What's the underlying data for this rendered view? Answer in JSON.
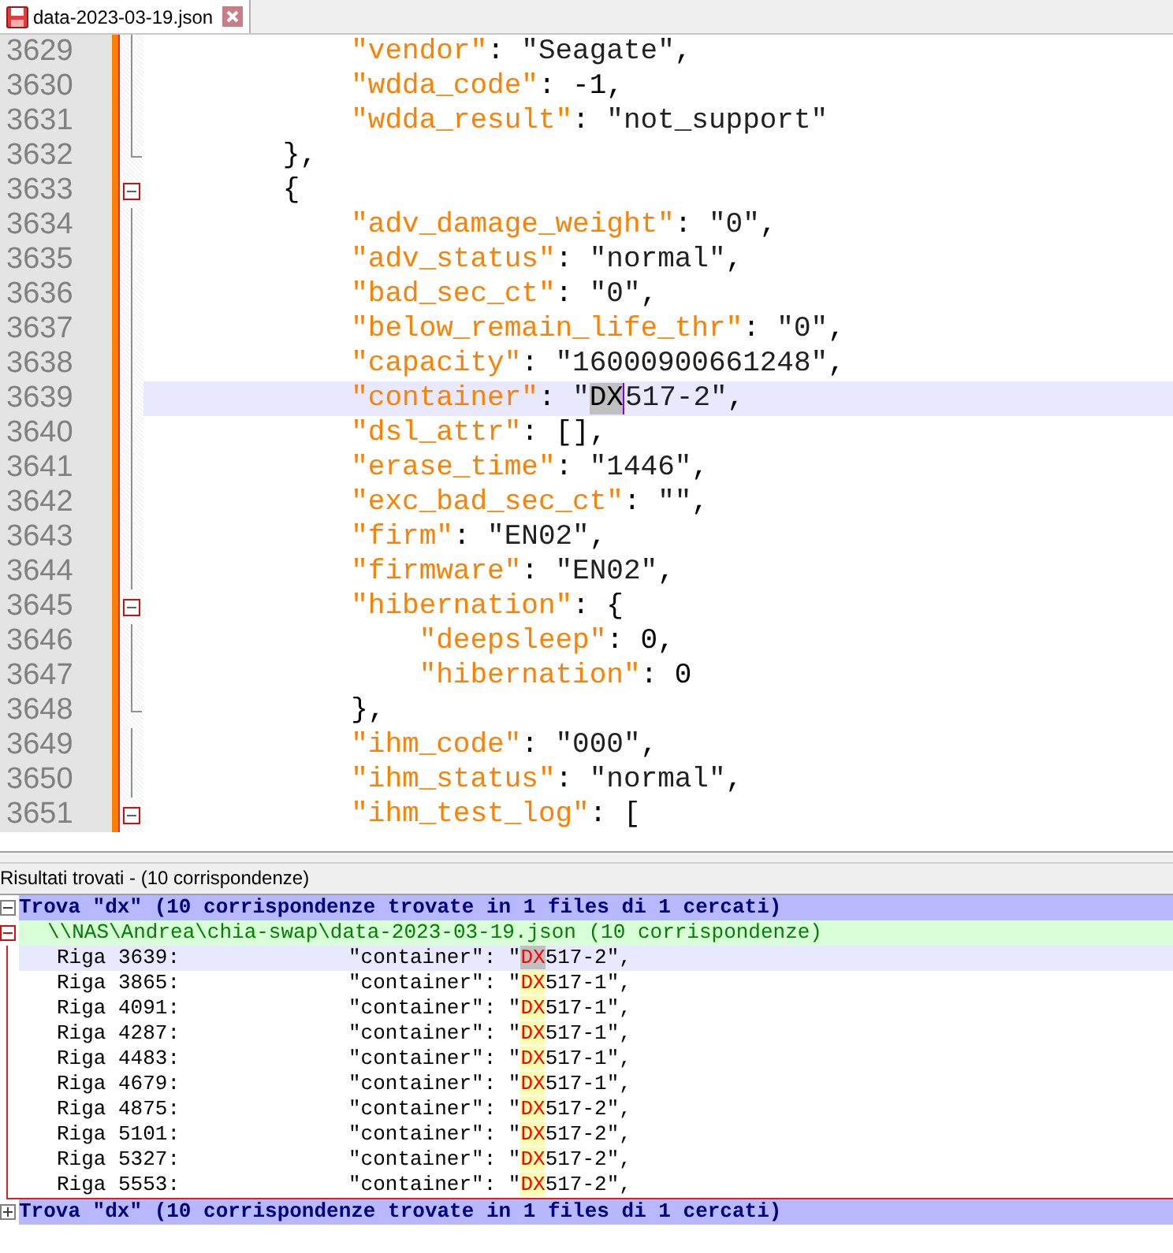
{
  "tab": {
    "title": "data-2023-03-19.json",
    "selected": true
  },
  "editor": {
    "lines": [
      {
        "number": "3629",
        "kind": "inner",
        "selected": false,
        "code": [
          {
            "kind": "key",
            "text": "            \"vendor\""
          },
          {
            "kind": "plain",
            "text": ": "
          },
          {
            "kind": "string",
            "text": "\"Seagate\""
          },
          {
            "kind": "plain",
            "text": ","
          }
        ]
      },
      {
        "number": "3630",
        "kind": "inner",
        "selected": false,
        "code": [
          {
            "kind": "key",
            "text": "            \"wdda_code\""
          },
          {
            "kind": "plain",
            "text": ": -1,"
          }
        ]
      },
      {
        "number": "3631",
        "kind": "inner",
        "selected": false,
        "code": [
          {
            "kind": "key",
            "text": "            \"wdda_result\""
          },
          {
            "kind": "plain",
            "text": ": "
          },
          {
            "kind": "string",
            "text": "\"not_support\""
          }
        ]
      },
      {
        "number": "3632",
        "kind": "close",
        "selected": false,
        "code": [
          {
            "kind": "plain",
            "text": "        },"
          }
        ]
      },
      {
        "number": "3633",
        "kind": "open",
        "selected": false,
        "code": [
          {
            "kind": "plain",
            "text": "        {"
          }
        ]
      },
      {
        "number": "3634",
        "kind": "inner",
        "selected": false,
        "code": [
          {
            "kind": "key",
            "text": "            \"adv_damage_weight\""
          },
          {
            "kind": "plain",
            "text": ": "
          },
          {
            "kind": "string",
            "text": "\"0\""
          },
          {
            "kind": "plain",
            "text": ","
          }
        ]
      },
      {
        "number": "3635",
        "kind": "inner",
        "selected": false,
        "code": [
          {
            "kind": "key",
            "text": "            \"adv_status\""
          },
          {
            "kind": "plain",
            "text": ": "
          },
          {
            "kind": "string",
            "text": "\"normal\""
          },
          {
            "kind": "plain",
            "text": ","
          }
        ]
      },
      {
        "number": "3636",
        "kind": "inner",
        "selected": false,
        "code": [
          {
            "kind": "key",
            "text": "            \"bad_sec_ct\""
          },
          {
            "kind": "plain",
            "text": ": "
          },
          {
            "kind": "string",
            "text": "\"0\""
          },
          {
            "kind": "plain",
            "text": ","
          }
        ]
      },
      {
        "number": "3637",
        "kind": "inner",
        "selected": false,
        "code": [
          {
            "kind": "key",
            "text": "            \"below_remain_life_thr\""
          },
          {
            "kind": "plain",
            "text": ": "
          },
          {
            "kind": "string",
            "text": "\"0\""
          },
          {
            "kind": "plain",
            "text": ","
          }
        ]
      },
      {
        "number": "3638",
        "kind": "inner",
        "selected": false,
        "code": [
          {
            "kind": "key",
            "text": "            \"capacity\""
          },
          {
            "kind": "plain",
            "text": ": "
          },
          {
            "kind": "string",
            "text": "\"16000900661248\""
          },
          {
            "kind": "plain",
            "text": ","
          }
        ]
      },
      {
        "number": "3639",
        "kind": "inner",
        "selected": true,
        "code": [
          {
            "kind": "key",
            "text": "            \"container\""
          },
          {
            "kind": "plain",
            "text": ": "
          },
          {
            "kind": "string",
            "text": "\""
          },
          {
            "kind": "match",
            "text": "DX"
          },
          {
            "kind": "string",
            "text": "517-2\""
          },
          {
            "kind": "plain",
            "text": ","
          }
        ]
      },
      {
        "number": "3640",
        "kind": "inner",
        "selected": false,
        "code": [
          {
            "kind": "key",
            "text": "            \"dsl_attr\""
          },
          {
            "kind": "plain",
            "text": ": [],"
          }
        ]
      },
      {
        "number": "3641",
        "kind": "inner",
        "selected": false,
        "code": [
          {
            "kind": "key",
            "text": "            \"erase_time\""
          },
          {
            "kind": "plain",
            "text": ": "
          },
          {
            "kind": "string",
            "text": "\"1446\""
          },
          {
            "kind": "plain",
            "text": ","
          }
        ]
      },
      {
        "number": "3642",
        "kind": "inner",
        "selected": false,
        "code": [
          {
            "kind": "key",
            "text": "            \"exc_bad_sec_ct\""
          },
          {
            "kind": "plain",
            "text": ": "
          },
          {
            "kind": "string",
            "text": "\"\""
          },
          {
            "kind": "plain",
            "text": ","
          }
        ]
      },
      {
        "number": "3643",
        "kind": "inner",
        "selected": false,
        "code": [
          {
            "kind": "key",
            "text": "            \"firm\""
          },
          {
            "kind": "plain",
            "text": ": "
          },
          {
            "kind": "string",
            "text": "\"EN02\""
          },
          {
            "kind": "plain",
            "text": ","
          }
        ]
      },
      {
        "number": "3644",
        "kind": "inner",
        "selected": false,
        "code": [
          {
            "kind": "key",
            "text": "            \"firmware\""
          },
          {
            "kind": "plain",
            "text": ": "
          },
          {
            "kind": "string",
            "text": "\"EN02\""
          },
          {
            "kind": "plain",
            "text": ","
          }
        ]
      },
      {
        "number": "3645",
        "kind": "open",
        "selected": false,
        "code": [
          {
            "kind": "key",
            "text": "            \"hibernation\""
          },
          {
            "kind": "plain",
            "text": ": {"
          }
        ]
      },
      {
        "number": "3646",
        "kind": "inner",
        "selected": false,
        "code": [
          {
            "kind": "key",
            "text": "                \"deepsleep\""
          },
          {
            "kind": "plain",
            "text": ": 0,"
          }
        ]
      },
      {
        "number": "3647",
        "kind": "inner",
        "selected": false,
        "code": [
          {
            "kind": "key",
            "text": "                \"hibernation\""
          },
          {
            "kind": "plain",
            "text": ": 0"
          }
        ]
      },
      {
        "number": "3648",
        "kind": "close",
        "selected": false,
        "code": [
          {
            "kind": "plain",
            "text": "            },"
          }
        ]
      },
      {
        "number": "3649",
        "kind": "inner",
        "selected": false,
        "code": [
          {
            "kind": "key",
            "text": "            \"ihm_code\""
          },
          {
            "kind": "plain",
            "text": ": "
          },
          {
            "kind": "string",
            "text": "\"000\""
          },
          {
            "kind": "plain",
            "text": ","
          }
        ]
      },
      {
        "number": "3650",
        "kind": "inner",
        "selected": false,
        "code": [
          {
            "kind": "key",
            "text": "            \"ihm_status\""
          },
          {
            "kind": "plain",
            "text": ": "
          },
          {
            "kind": "string",
            "text": "\"normal\""
          },
          {
            "kind": "plain",
            "text": ","
          }
        ]
      },
      {
        "number": "3651",
        "kind": "open",
        "selected": false,
        "code": [
          {
            "kind": "key",
            "text": "            \"ihm_test_log\""
          },
          {
            "kind": "plain",
            "text": ": ["
          }
        ]
      }
    ]
  },
  "results": {
    "title": "Risultati trovati - (10 corrispondenze)",
    "search_header": "Trova \"dx\" (10 corrispondenze trovate in 1 files di 1 cercati)",
    "file": "\\\\NAS\\Andrea\\chia-swap\\data-2023-03-19.json (10 corrispondenze)",
    "rows": [
      {
        "label": "Riga 3639:",
        "before": "\"container\": \"",
        "match": "DX",
        "after": "517-2\",",
        "selected": true
      },
      {
        "label": "Riga 3865:",
        "before": "\"container\": \"",
        "match": "DX",
        "after": "517-1\",",
        "selected": false
      },
      {
        "label": "Riga 4091:",
        "before": "\"container\": \"",
        "match": "DX",
        "after": "517-1\",",
        "selected": false
      },
      {
        "label": "Riga 4287:",
        "before": "\"container\": \"",
        "match": "DX",
        "after": "517-1\",",
        "selected": false
      },
      {
        "label": "Riga 4483:",
        "before": "\"container\": \"",
        "match": "DX",
        "after": "517-1\",",
        "selected": false
      },
      {
        "label": "Riga 4679:",
        "before": "\"container\": \"",
        "match": "DX",
        "after": "517-1\",",
        "selected": false
      },
      {
        "label": "Riga 4875:",
        "before": "\"container\": \"",
        "match": "DX",
        "after": "517-2\",",
        "selected": false
      },
      {
        "label": "Riga 5101:",
        "before": "\"container\": \"",
        "match": "DX",
        "after": "517-2\",",
        "selected": false
      },
      {
        "label": "Riga 5327:",
        "before": "\"container\": \"",
        "match": "DX",
        "after": "517-2\",",
        "selected": false
      },
      {
        "label": "Riga 5553:",
        "before": "\"container\": \"",
        "match": "DX",
        "after": "517-2\",",
        "selected": false
      }
    ],
    "footer_header": "Trova \"dx\" (10 corrispondenze trovate in 1 files di 1 cercati)"
  }
}
